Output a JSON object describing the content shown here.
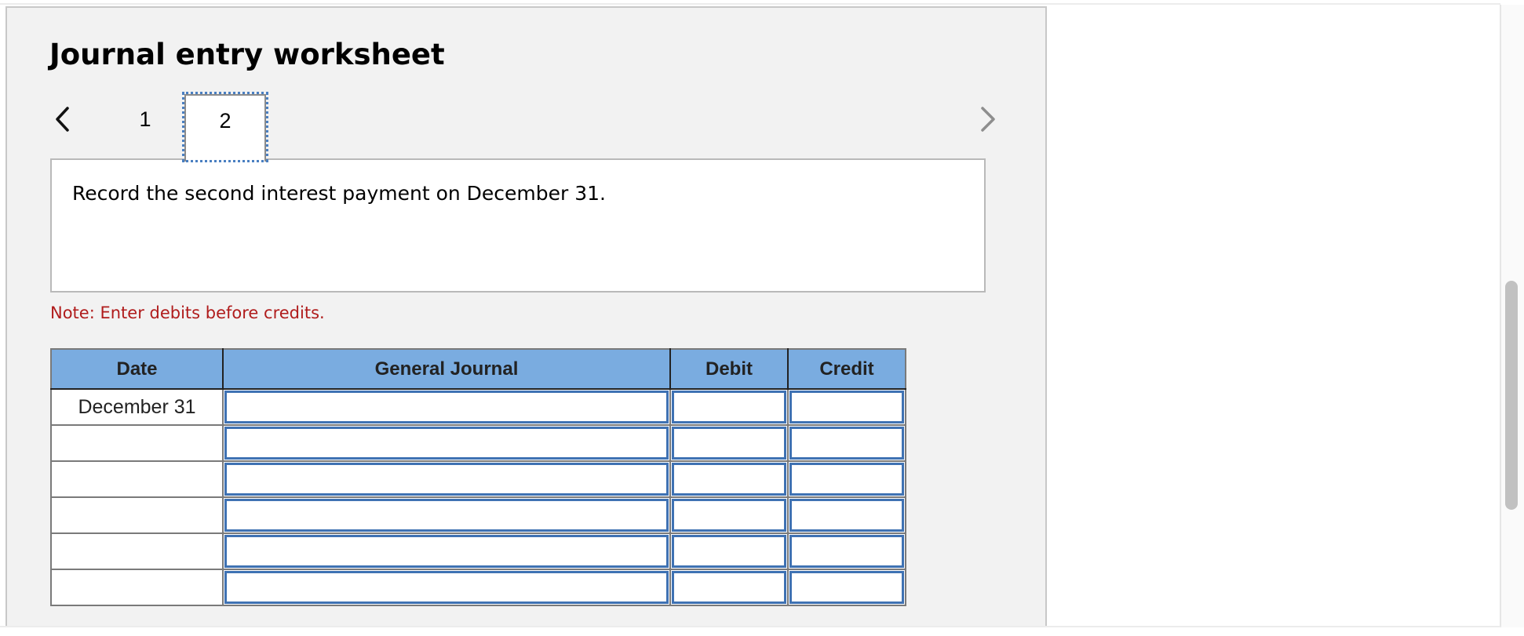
{
  "worksheet": {
    "title": "Journal entry worksheet",
    "nav": {
      "prev_icon": "chevron-left-icon",
      "next_icon": "chevron-right-icon",
      "tabs": [
        {
          "label": "1",
          "active": false
        },
        {
          "label": "2",
          "active": true
        }
      ]
    },
    "instruction": "Record the second interest payment on December 31.",
    "note": "Note: Enter debits before credits.",
    "colors": {
      "header_bg": "#7aace0",
      "input_border": "#3f72b3",
      "note_text": "#b01c1c",
      "focus_outline": "#4a7fc1"
    },
    "table": {
      "columns": [
        "Date",
        "General Journal",
        "Debit",
        "Credit"
      ],
      "rows": [
        {
          "date": "December 31",
          "account": "",
          "debit": "",
          "credit": ""
        },
        {
          "date": "",
          "account": "",
          "debit": "",
          "credit": ""
        },
        {
          "date": "",
          "account": "",
          "debit": "",
          "credit": ""
        },
        {
          "date": "",
          "account": "",
          "debit": "",
          "credit": ""
        },
        {
          "date": "",
          "account": "",
          "debit": "",
          "credit": ""
        },
        {
          "date": "",
          "account": "",
          "debit": "",
          "credit": ""
        }
      ]
    }
  }
}
